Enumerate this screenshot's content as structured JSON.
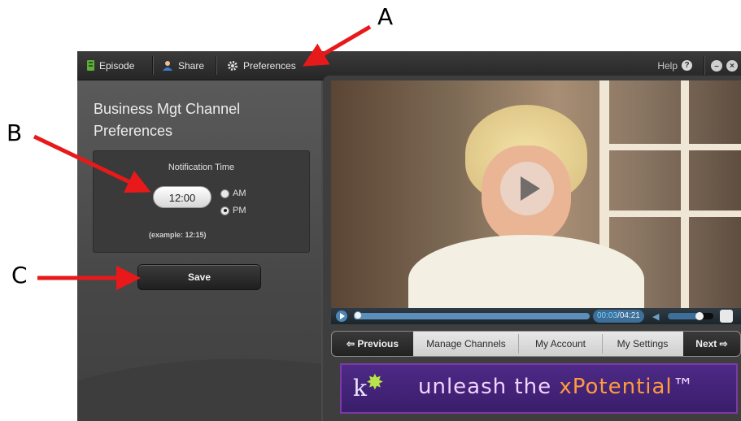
{
  "annotations": {
    "a": "A",
    "b": "B",
    "c": "C"
  },
  "tabs": [
    {
      "label": "Episode",
      "icon": "episode-icon"
    },
    {
      "label": "Share",
      "icon": "share-icon"
    },
    {
      "label": "Preferences",
      "icon": "gear-icon"
    }
  ],
  "help_label": "Help",
  "preferences": {
    "title": "Business Mgt Channel Preferences",
    "notification_label": "Notification Time",
    "time_value": "12:00",
    "am_label": "AM",
    "pm_label": "PM",
    "selected_period": "PM",
    "example_text": "(example: 12:15)",
    "save_label": "Save"
  },
  "player": {
    "current_time": "00:03",
    "separator": "/",
    "duration": "04:21",
    "progress_fraction": 0.012,
    "volume_fraction": 0.7
  },
  "nav": {
    "previous_label": "Previous",
    "manage_channels_label": "Manage Channels",
    "my_account_label": "My Account",
    "my_settings_label": "My Settings",
    "next_label": "Next"
  },
  "banner": {
    "logo_letter": "k",
    "slogan_pre": "unleash the ",
    "slogan_x": "x",
    "slogan_post": "Potential",
    "trademark": "™"
  },
  "colors": {
    "arrow": "#e8191b",
    "accent_blue": "#3d6f99",
    "banner_purple": "#4d2a86"
  }
}
